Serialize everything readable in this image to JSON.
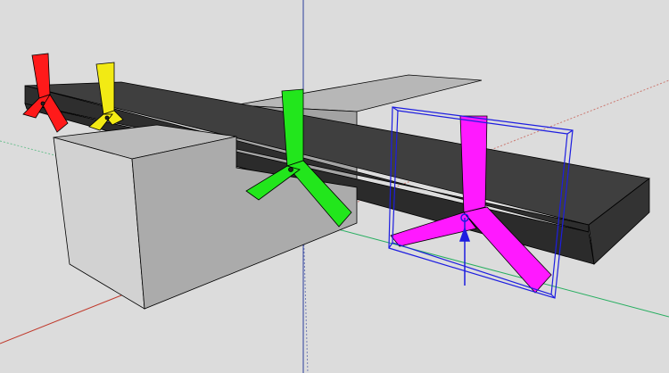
{
  "viewport": {
    "background_color": "#dcdcdc",
    "edge_color": "#000000",
    "axes": {
      "red_axis_color": "#c0392b",
      "green_axis_color": "#27ae60",
      "blue_axis_color": "#2c3e9c"
    }
  },
  "model": {
    "beam_color": "#3a3a3a",
    "box_colors": {
      "top": "#bcbcbc",
      "front": "#d2d2d2",
      "side": "#a9a9a9"
    },
    "components": [
      {
        "name": "y-connector-red",
        "color": "#ff1a1a",
        "selected": false
      },
      {
        "name": "y-connector-yellow",
        "color": "#f2ea14",
        "selected": false
      },
      {
        "name": "y-connector-green",
        "color": "#22e61c",
        "selected": false
      },
      {
        "name": "y-connector-magenta",
        "color": "#ff19ff",
        "selected": true
      }
    ],
    "selection_color": "#1d1de0"
  }
}
